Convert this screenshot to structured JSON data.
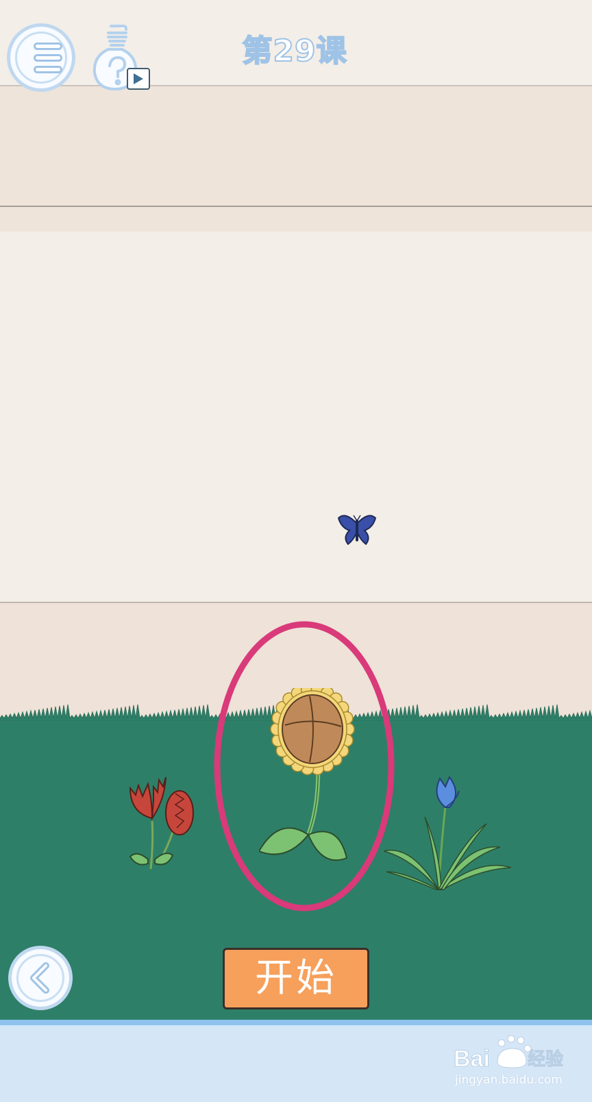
{
  "header": {
    "level_title": "第29课",
    "menu_icon": "hamburger-menu-icon",
    "hint_icon": "lightbulb-hint-icon",
    "hint_video_icon": "play-icon"
  },
  "scene": {
    "sprites": [
      "butterfly",
      "venus-flytrap",
      "sunflower",
      "blue-flower"
    ],
    "highlighted": "sunflower",
    "colors": {
      "wall": "#f3eee7",
      "floor": "#efe2d8",
      "grass": "#2e7f68",
      "water": "#d5e6f7",
      "highlight": "#d93a7a"
    }
  },
  "controls": {
    "back_icon": "back-arrow-icon",
    "start_label": "开始",
    "start_color": "#f6a05c"
  },
  "watermark": {
    "logo_text": "Baidu经验",
    "url": "jingyan.baidu.com"
  }
}
